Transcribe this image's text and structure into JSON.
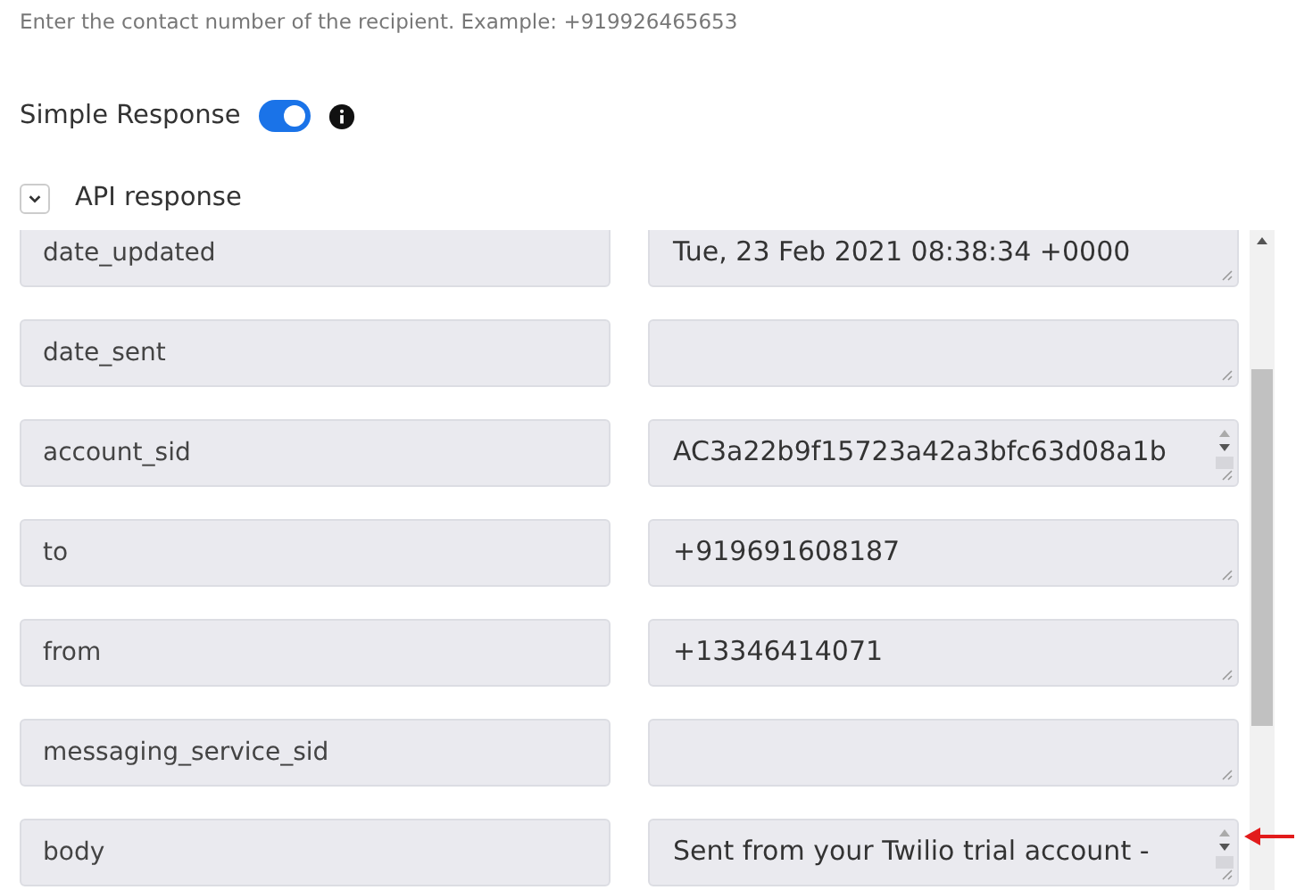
{
  "hint": "Enter the contact number of the recipient. Example: +919926465653",
  "simple_response": {
    "label": "Simple Response",
    "on": true
  },
  "api_response": {
    "label": "API response",
    "expanded": true
  },
  "fields": [
    {
      "key": "date_updated",
      "value": "Tue, 23 Feb 2021 08:38:34 +0000",
      "spinner": false
    },
    {
      "key": "date_sent",
      "spinner": false
    },
    {
      "key": "account_sid",
      "value": "AC3a22b9f15723a42a3bfc63d08a1b",
      "spinner": true
    },
    {
      "key": "to",
      "value": "+919691608187",
      "spinner": false
    },
    {
      "key": "from",
      "value": "+13346414071",
      "spinner": false
    },
    {
      "key": "messaging_service_sid",
      "spinner": false
    },
    {
      "key": "body",
      "value": "Sent from your Twilio trial account -",
      "spinner": true
    }
  ]
}
